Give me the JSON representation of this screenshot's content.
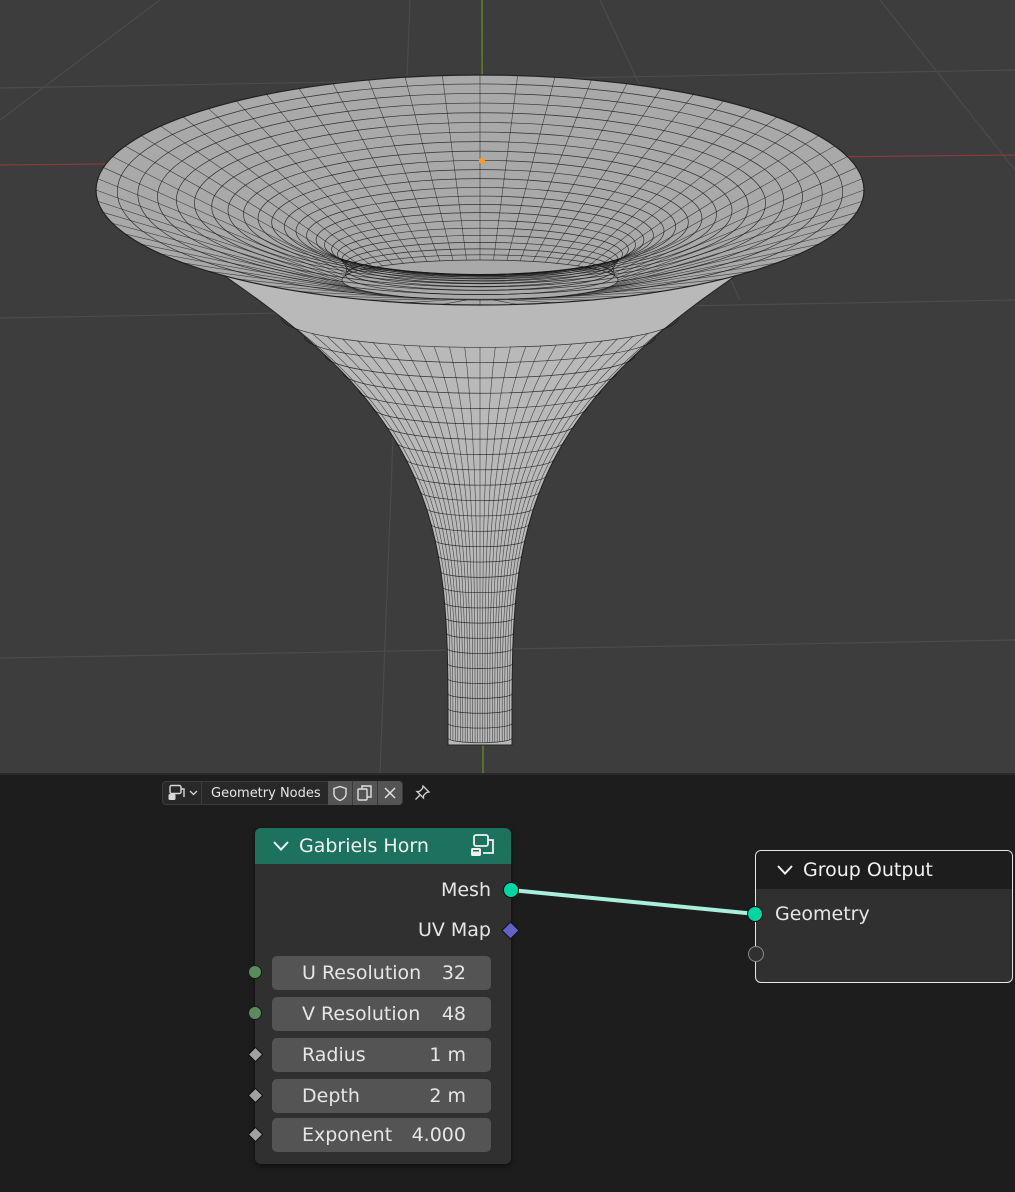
{
  "viewport": {
    "object": "Gabriel's horn mesh",
    "colors": {
      "background": "#3d3d3d",
      "grid": "#4b4b4b",
      "x_axis": "#8b3a3a",
      "y_axis": "#6a8a2a",
      "mesh": "#b9b9b9",
      "wire": "#111111"
    }
  },
  "node_editor": {
    "header": {
      "editor_type_icon": "node-tree-icon",
      "tree_name": "Geometry Nodes",
      "fake_user_icon": "shield-icon",
      "duplicate_icon": "duplicate-icon",
      "unlink_icon": "close-icon",
      "pin_icon": "pin-icon"
    },
    "nodes": {
      "group": {
        "title": "Gabriels Horn",
        "header_color": "#1d725e",
        "outputs": [
          {
            "label": "Mesh",
            "socket": "geometry"
          },
          {
            "label": "UV Map",
            "socket": "vector"
          }
        ],
        "inputs": [
          {
            "label": "U Resolution",
            "value": "32",
            "socket": "integer"
          },
          {
            "label": "V Resolution",
            "value": "48",
            "socket": "integer"
          },
          {
            "label": "Radius",
            "value": "1 m",
            "socket": "float"
          },
          {
            "label": "Depth",
            "value": "2 m",
            "socket": "float"
          },
          {
            "label": "Exponent",
            "value": "4.000",
            "socket": "float"
          }
        ]
      },
      "output": {
        "title": "Group Output",
        "inputs": [
          {
            "label": "Geometry",
            "socket": "geometry"
          }
        ]
      }
    },
    "link_color": "#a8f0dc"
  }
}
